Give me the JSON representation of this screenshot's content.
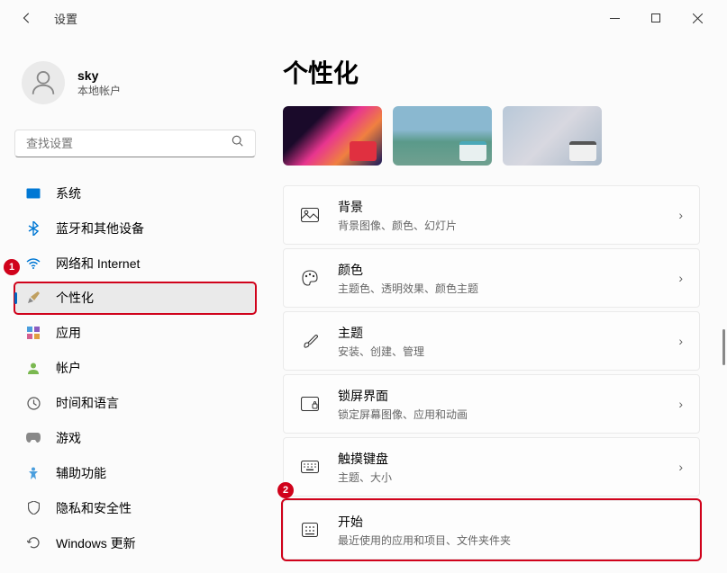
{
  "app_title": "设置",
  "user": {
    "name": "sky",
    "type": "本地帐户"
  },
  "search": {
    "placeholder": "查找设置"
  },
  "page": {
    "title": "个性化"
  },
  "nav": [
    {
      "label": "系统"
    },
    {
      "label": "蓝牙和其他设备"
    },
    {
      "label": "网络和 Internet"
    },
    {
      "label": "个性化"
    },
    {
      "label": "应用"
    },
    {
      "label": "帐户"
    },
    {
      "label": "时间和语言"
    },
    {
      "label": "游戏"
    },
    {
      "label": "辅助功能"
    },
    {
      "label": "隐私和安全性"
    },
    {
      "label": "Windows 更新"
    }
  ],
  "settings_items": [
    {
      "title": "背景",
      "desc": "背景图像、颜色、幻灯片"
    },
    {
      "title": "颜色",
      "desc": "主题色、透明效果、颜色主题"
    },
    {
      "title": "主题",
      "desc": "安装、创建、管理"
    },
    {
      "title": "锁屏界面",
      "desc": "锁定屏幕图像、应用和动画"
    },
    {
      "title": "触摸键盘",
      "desc": "主题、大小"
    },
    {
      "title": "开始",
      "desc": "最近使用的应用和项目、文件夹件夹"
    }
  ],
  "markers": {
    "m1": "1",
    "m2": "2"
  }
}
